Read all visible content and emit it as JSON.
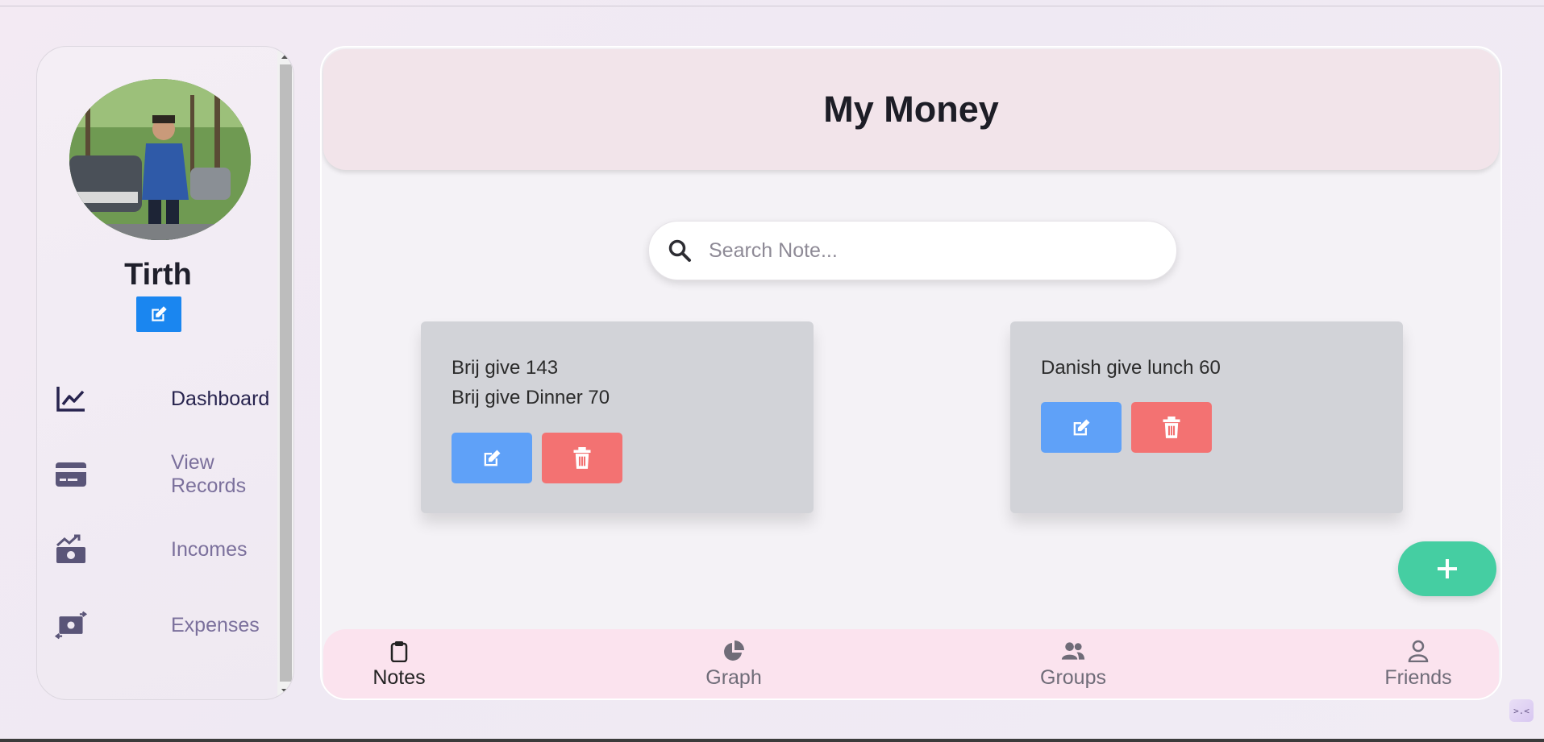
{
  "app": {
    "title": "My Money"
  },
  "user": {
    "name": "Tirth"
  },
  "sidebar": {
    "items": [
      {
        "label": "Dashboard",
        "icon": "chart-line-icon",
        "active": true
      },
      {
        "label": "View Records",
        "icon": "credit-card-icon",
        "active": false
      },
      {
        "label": "Incomes",
        "icon": "money-bill-trend-up-icon",
        "active": false
      },
      {
        "label": "Expenses",
        "icon": "money-bill-transfer-icon",
        "active": false
      }
    ]
  },
  "search": {
    "placeholder": "Search Note...",
    "value": ""
  },
  "notes": [
    {
      "lines": [
        "Brij give 143",
        "Brij give Dinner 70"
      ]
    },
    {
      "lines": [
        "Danish give lunch 60"
      ]
    }
  ],
  "fab": {
    "label": "+"
  },
  "bottom_nav": {
    "items": [
      {
        "label": "Notes",
        "icon": "clipboard-icon",
        "active": true
      },
      {
        "label": "Graph",
        "icon": "pie-chart-icon",
        "active": false
      },
      {
        "label": "Groups",
        "icon": "users-icon",
        "active": false
      },
      {
        "label": "Friends",
        "icon": "user-icon",
        "active": false
      }
    ]
  },
  "colors": {
    "accent_blue": "#1a86f0",
    "edit_button": "#5fa1f8",
    "delete_button": "#f37272",
    "fab": "#45cea2",
    "header_bg": "#f2e4ea",
    "bottom_nav_bg": "#fbe3ee"
  }
}
